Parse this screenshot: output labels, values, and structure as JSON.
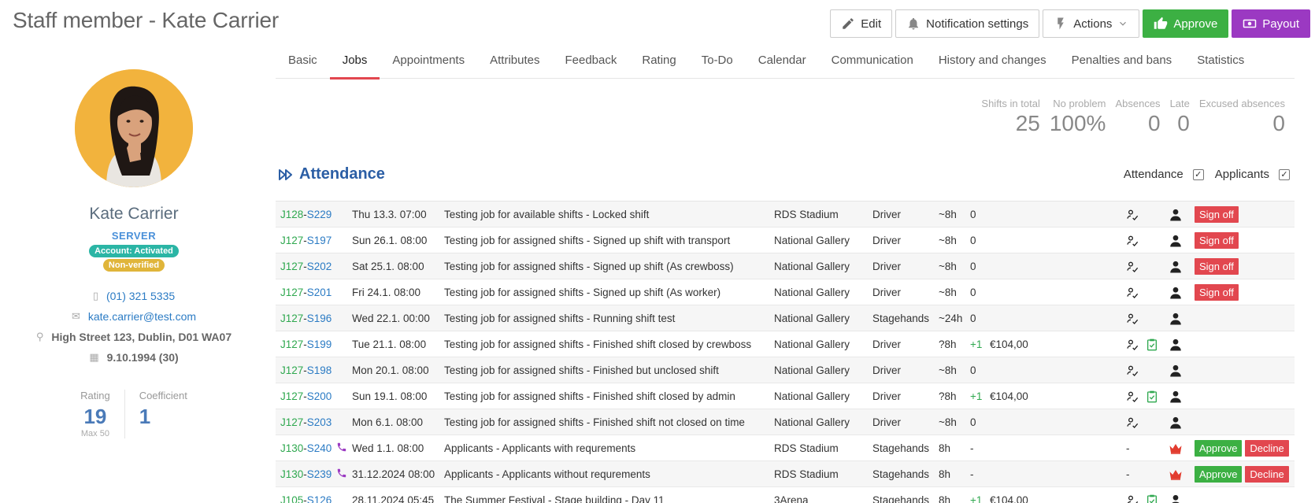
{
  "header": {
    "title": "Staff member - Kate Carrier",
    "edit_label": "Edit",
    "notifications_label": "Notification settings",
    "actions_label": "Actions",
    "approve_label": "Approve",
    "payout_label": "Payout"
  },
  "profile": {
    "name": "Kate Carrier",
    "role": "SERVER",
    "account_badge": "Account: Activated",
    "verification_badge": "Non-verified",
    "phone": "(01) 321 5335",
    "email": "kate.carrier@test.com",
    "address": "High Street 123, Dublin, D01 WA07",
    "dob": "9.10.1994 (30)",
    "rating_label": "Rating",
    "rating_value": "19",
    "rating_max": "Max 50",
    "coefficient_label": "Coefficient",
    "coefficient_value": "1"
  },
  "tabs": [
    "Basic",
    "Jobs",
    "Appointments",
    "Attributes",
    "Feedback",
    "Rating",
    "To-Do",
    "Calendar",
    "Communication",
    "History and changes",
    "Penalties and bans",
    "Statistics"
  ],
  "active_tab": "Jobs",
  "kpis": [
    {
      "label": "Shifts in total",
      "value": "25"
    },
    {
      "label": "No problem",
      "value": "100%"
    },
    {
      "label": "Absences",
      "value": "0"
    },
    {
      "label": "Late",
      "value": "0"
    },
    {
      "label": "Excused absences",
      "value": "0"
    }
  ],
  "attendance": {
    "title": "Attendance",
    "filter_attendance": "Attendance",
    "filter_applicants": "Applicants"
  },
  "rows": [
    {
      "job": "J128",
      "shift": "S229",
      "date": "Thu 13.3. 07:00",
      "name": "Testing job for available shifts - Locked shift",
      "venue": "RDS Stadium",
      "position": "Driver",
      "duration": "~8h",
      "value": "0",
      "amount": "",
      "action": "Sign off"
    },
    {
      "job": "J127",
      "shift": "S197",
      "date": "Sun 26.1. 08:00",
      "name": "Testing job for assigned shifts - Signed up shift with transport",
      "venue": "National Gallery",
      "position": "Driver",
      "duration": "~8h",
      "value": "0",
      "amount": "",
      "action": "Sign off"
    },
    {
      "job": "J127",
      "shift": "S202",
      "date": "Sat 25.1. 08:00",
      "name": "Testing job for assigned shifts - Signed up shift (As crewboss)",
      "venue": "National Gallery",
      "position": "Driver",
      "duration": "~8h",
      "value": "0",
      "amount": "",
      "action": "Sign off"
    },
    {
      "job": "J127",
      "shift": "S201",
      "date": "Fri 24.1. 08:00",
      "name": "Testing job for assigned shifts - Signed up shift (As worker)",
      "venue": "National Gallery",
      "position": "Driver",
      "duration": "~8h",
      "value": "0",
      "amount": "",
      "action": "Sign off"
    },
    {
      "job": "J127",
      "shift": "S196",
      "date": "Wed 22.1. 00:00",
      "name": "Testing job for assigned shifts - Running shift test",
      "venue": "National Gallery",
      "position": "Stagehands",
      "duration": "~24h",
      "value": "0",
      "amount": "",
      "action": ""
    },
    {
      "job": "J127",
      "shift": "S199",
      "date": "Tue 21.1. 08:00",
      "name": "Testing job for assigned shifts - Finished shift closed by crewboss",
      "venue": "National Gallery",
      "position": "Driver",
      "duration": "?8h",
      "value": "+1",
      "amount": "€104,00",
      "action": ""
    },
    {
      "job": "J127",
      "shift": "S198",
      "date": "Mon 20.1. 08:00",
      "name": "Testing job for assigned shifts - Finished but unclosed shift",
      "venue": "National Gallery",
      "position": "Driver",
      "duration": "~8h",
      "value": "0",
      "amount": "",
      "action": ""
    },
    {
      "job": "J127",
      "shift": "S200",
      "date": "Sun 19.1. 08:00",
      "name": "Testing job for assigned shifts - Finished shift closed by admin",
      "venue": "National Gallery",
      "position": "Driver",
      "duration": "?8h",
      "value": "+1",
      "amount": "€104,00",
      "action": ""
    },
    {
      "job": "J127",
      "shift": "S203",
      "date": "Mon 6.1. 08:00",
      "name": "Testing job for assigned shifts - Finished shift not closed on time",
      "venue": "National Gallery",
      "position": "Driver",
      "duration": "~8h",
      "value": "0",
      "amount": "",
      "action": ""
    },
    {
      "job": "J130",
      "shift": "S240",
      "date": "Wed 1.1. 08:00",
      "name": "Applicants - Applicants with requrements",
      "venue": "RDS Stadium",
      "position": "Stagehands",
      "duration": "8h",
      "value": "-",
      "amount": "",
      "action": "applicant"
    },
    {
      "job": "J130",
      "shift": "S239",
      "date": "31.12.2024 08:00",
      "name": "Applicants - Applicants without requrements",
      "venue": "RDS Stadium",
      "position": "Stagehands",
      "duration": "8h",
      "value": "-",
      "amount": "",
      "action": "applicant"
    },
    {
      "job": "J105",
      "shift": "S126",
      "date": "28.11.2024 05:45",
      "name": "The Summer Festival - Stage building - Day 11",
      "venue": "3Arena",
      "position": "Stagehands",
      "duration": "8h",
      "value": "+1",
      "amount": "€104,00",
      "action": ""
    }
  ],
  "labels": {
    "approve": "Approve",
    "decline": "Decline",
    "dash": "-"
  }
}
